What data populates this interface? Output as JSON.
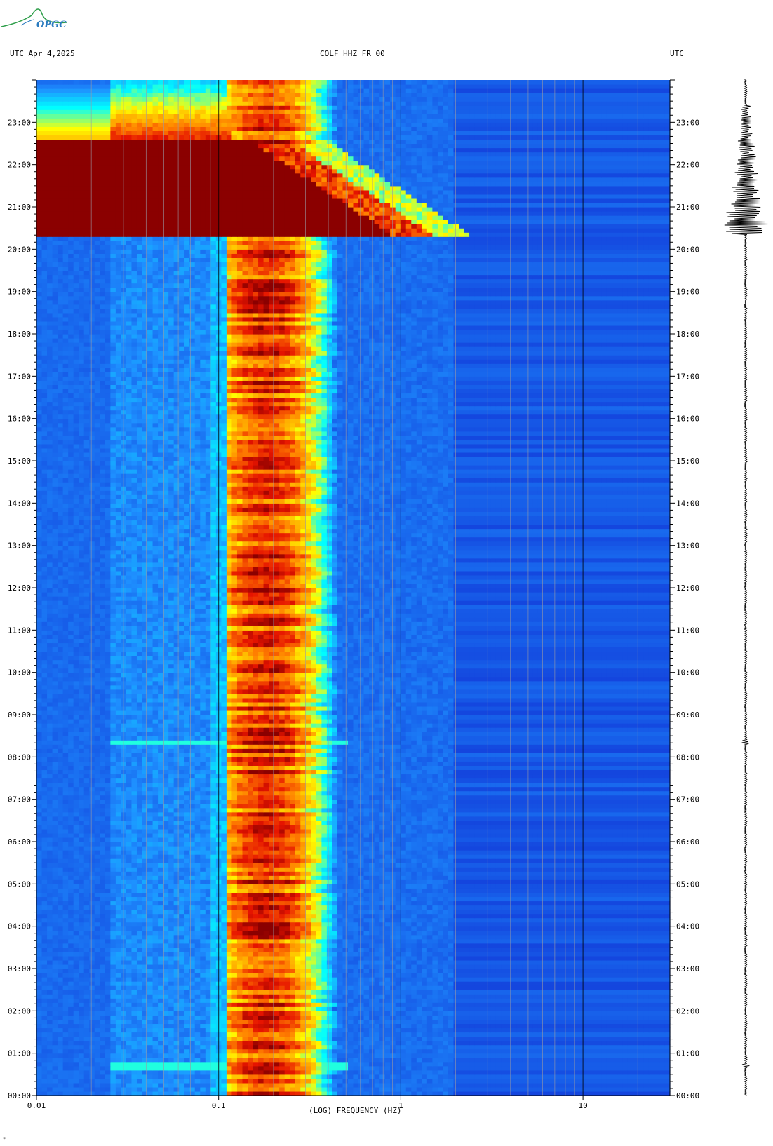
{
  "header": {
    "left_label": "UTC  Apr 4,2025",
    "center_label": "COLF HHZ FR 00",
    "right_label": "UTC"
  },
  "logo": {
    "text": "OPGC"
  },
  "chart_data": {
    "type": "heatmap",
    "title": "COLF HHZ FR 00",
    "xlabel": "(LOG) FREQUENCY (HZ)",
    "x_scale": "log",
    "xlim": [
      0.01,
      30
    ],
    "x_ticks": [
      {
        "value": 0.01,
        "label": "0.01"
      },
      {
        "value": 0.1,
        "label": "0.1"
      },
      {
        "value": 1,
        "label": "1"
      },
      {
        "value": 10,
        "label": "10"
      }
    ],
    "ylim_hours": [
      0,
      24
    ],
    "y_ticks": [
      "00:00",
      "01:00",
      "02:00",
      "03:00",
      "04:00",
      "05:00",
      "06:00",
      "07:00",
      "08:00",
      "09:00",
      "10:00",
      "11:00",
      "12:00",
      "13:00",
      "14:00",
      "15:00",
      "16:00",
      "17:00",
      "18:00",
      "19:00",
      "20:00",
      "21:00",
      "22:00",
      "23:00"
    ],
    "colors": {
      "background": "#0a1fb0",
      "low": "#1238d8",
      "mid_low": "#1e90ff",
      "mid": "#00ffff",
      "mid_high": "#ffff00",
      "high": "#ff7f00",
      "peak": "#8b0000"
    },
    "microseism_band_hz": [
      0.12,
      0.35
    ],
    "event": {
      "start_hour": 20.35,
      "end_hour": 22.6,
      "max_freq_hz": 1.5,
      "spike_hour": 20.45
    },
    "minor_event_hours": [
      8.35,
      0.7
    ]
  }
}
